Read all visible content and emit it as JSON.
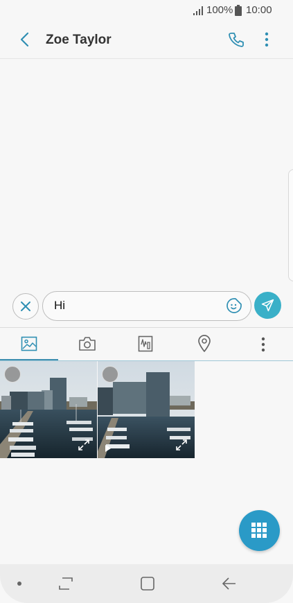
{
  "status_bar": {
    "battery": "100%",
    "time": "10:00",
    "icons": [
      "signal-icon",
      "battery-icon"
    ]
  },
  "header": {
    "title": "Zoe Taylor",
    "icons": [
      "back-arrow-icon",
      "phone-icon",
      "more-vert-icon"
    ]
  },
  "composer": {
    "message_text": "Hi",
    "icons": [
      "close-icon",
      "sticker-icon",
      "send-icon"
    ]
  },
  "attachment_tabs": [
    {
      "name": "gallery",
      "icon": "image-icon",
      "selected": true
    },
    {
      "name": "camera",
      "icon": "camera-icon",
      "selected": false
    },
    {
      "name": "handwriting",
      "icon": "drawing-icon",
      "selected": false
    },
    {
      "name": "location",
      "icon": "location-pin-icon",
      "selected": false
    },
    {
      "name": "more",
      "icon": "more-vert-icon",
      "selected": false
    }
  ],
  "gallery": {
    "items": [
      {
        "type": "photo",
        "selected": false
      },
      {
        "type": "video",
        "selected": false
      }
    ]
  },
  "fab": {
    "icon": "grid-icon"
  },
  "colors": {
    "accent": "#3ab0c8",
    "fab": "#2a9ac7",
    "tab_active": "#3e8fb0",
    "background": "#f7f7f7"
  },
  "nav_bar": {
    "icons": [
      "dot-icon",
      "recents-icon",
      "home-icon",
      "back-icon"
    ]
  }
}
